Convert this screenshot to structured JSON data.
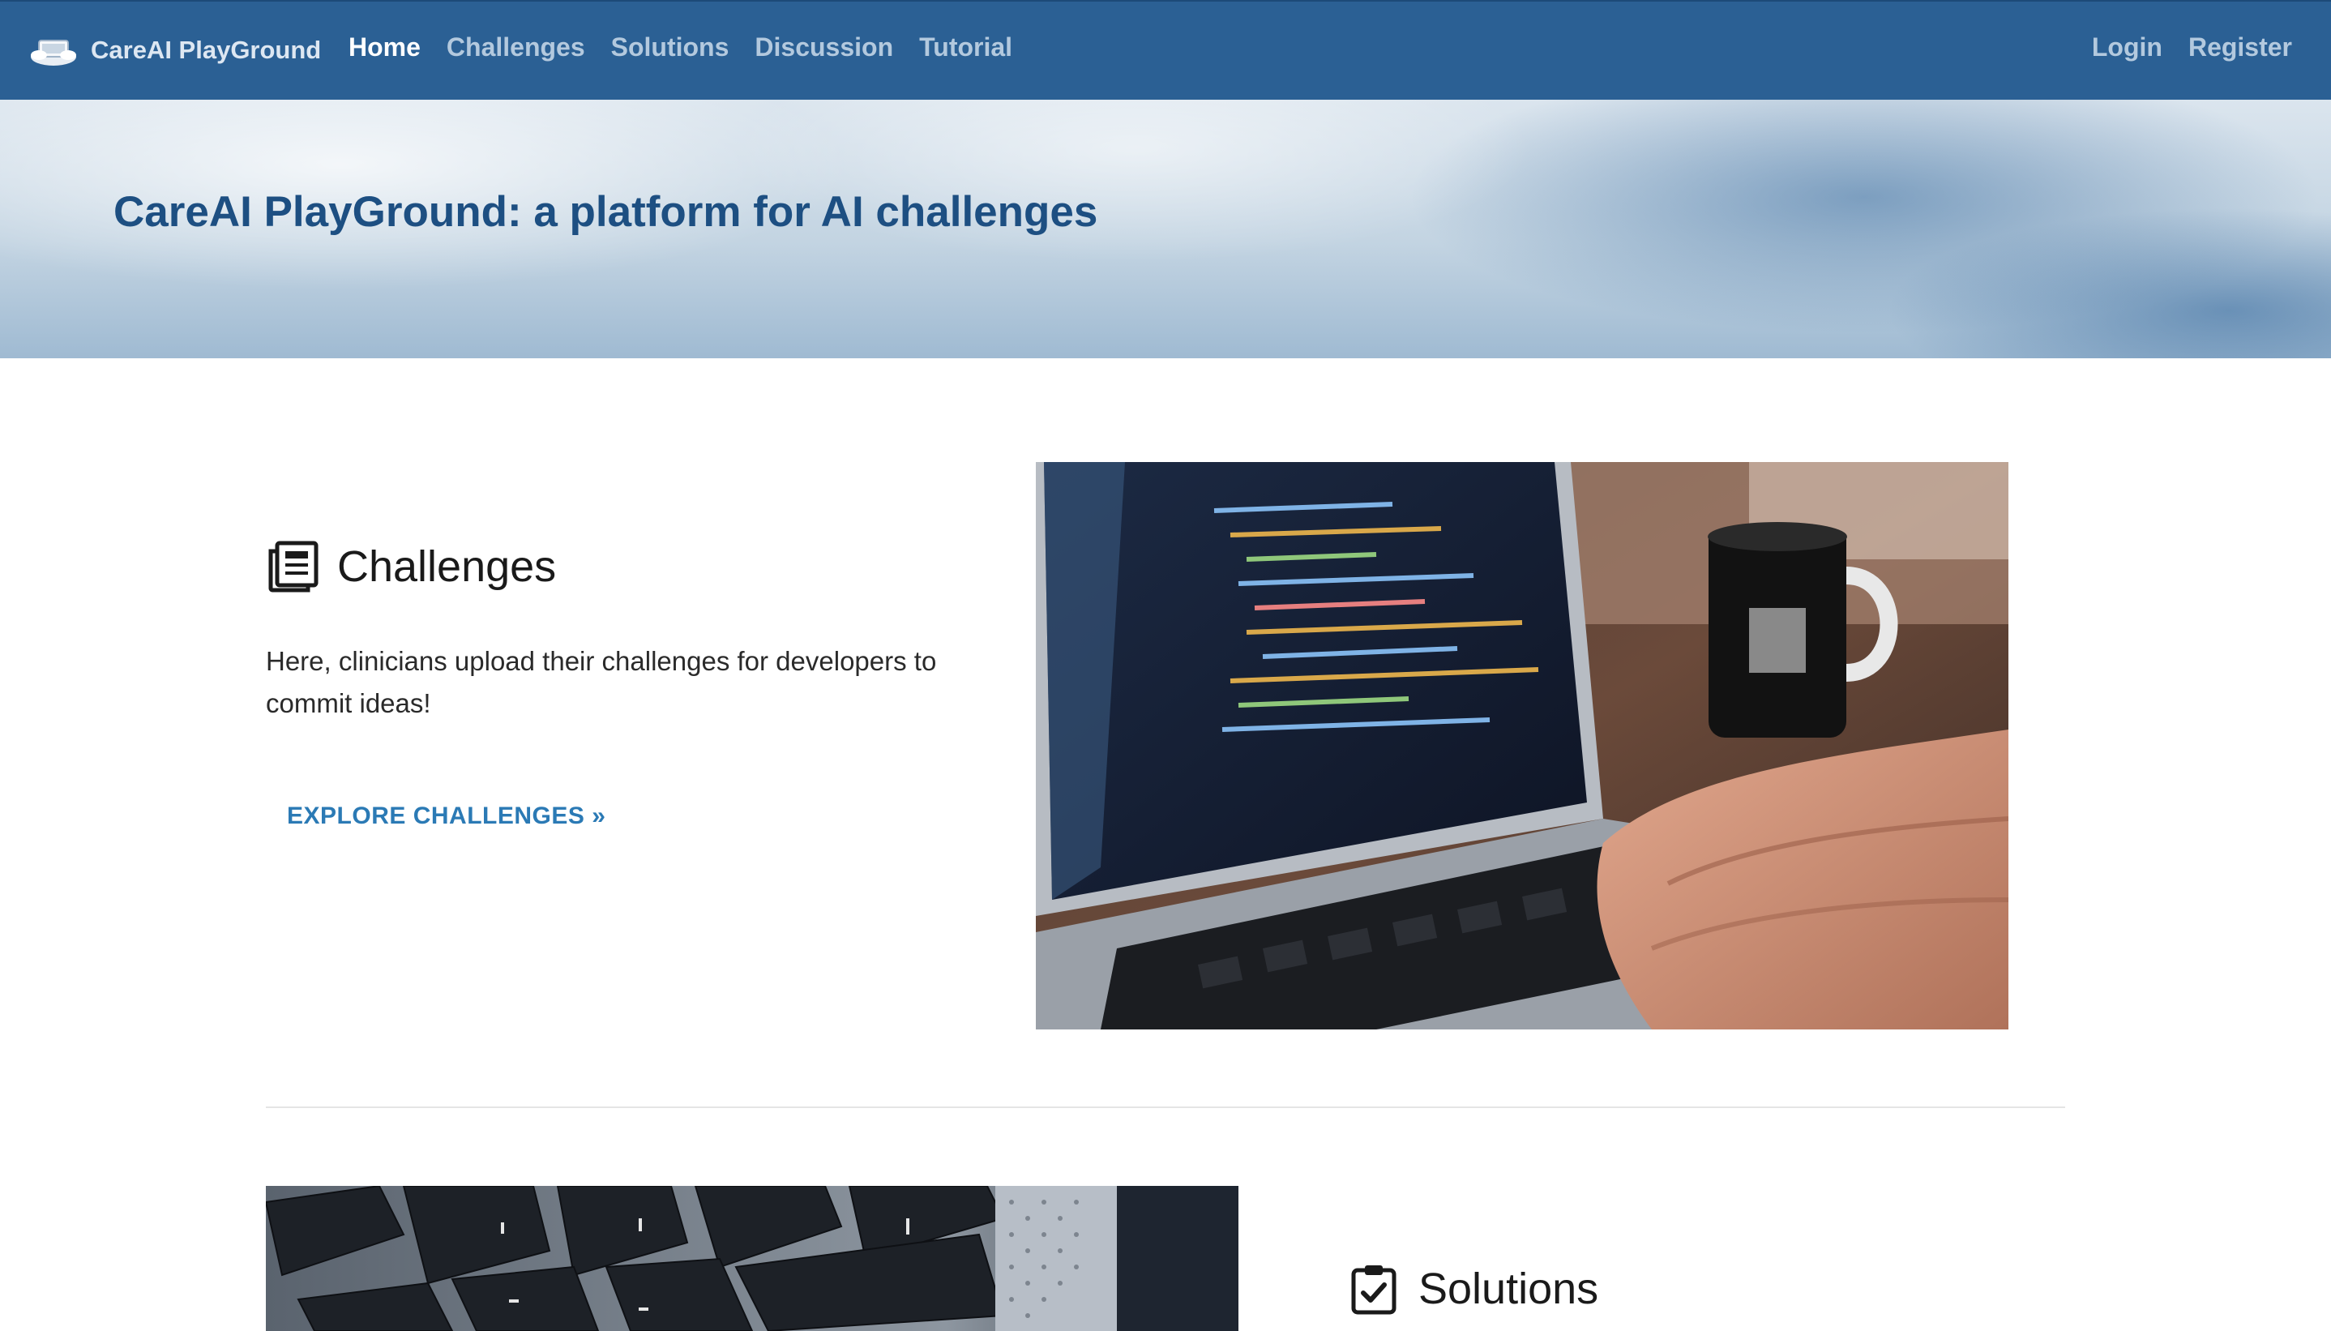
{
  "navbar": {
    "brand": "CareAI PlayGround",
    "links": [
      {
        "label": "Home",
        "active": true
      },
      {
        "label": "Challenges",
        "active": false
      },
      {
        "label": "Solutions",
        "active": false
      },
      {
        "label": "Discussion",
        "active": false
      },
      {
        "label": "Tutorial",
        "active": false
      }
    ],
    "right_links": [
      {
        "label": "Login"
      },
      {
        "label": "Register"
      }
    ]
  },
  "hero": {
    "title": "CareAI PlayGround: a platform for AI challenges"
  },
  "sections": {
    "challenges": {
      "icon": "newspaper-icon",
      "title": "Challenges",
      "description": "Here, clinicians upload their challenges for developers to commit ideas!",
      "button": "EXPLORE CHALLENGES »",
      "image": "laptop-coding-photo"
    },
    "solutions": {
      "icon": "clipboard-check-icon",
      "title": "Solutions",
      "image": "keyboard-closeup-photo"
    }
  },
  "colors": {
    "navbar": "#2b6094",
    "hero_title": "#1d4f82",
    "link": "#2b7ab5"
  }
}
